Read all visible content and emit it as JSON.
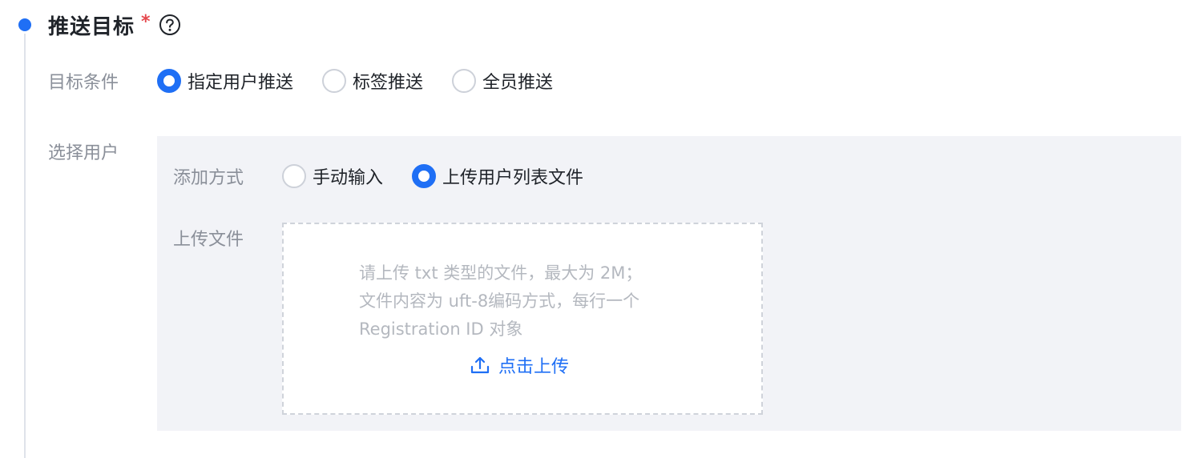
{
  "section": {
    "title": "推送目标",
    "required_mark": "*"
  },
  "target_condition": {
    "label": "目标条件",
    "options": [
      {
        "label": "指定用户推送",
        "checked": true
      },
      {
        "label": "标签推送",
        "checked": false
      },
      {
        "label": "全员推送",
        "checked": false
      }
    ]
  },
  "select_user": {
    "label": "选择用户",
    "add_method": {
      "label": "添加方式",
      "options": [
        {
          "label": "手动输入",
          "checked": false
        },
        {
          "label": "上传用户列表文件",
          "checked": true
        }
      ]
    },
    "upload": {
      "label": "上传文件",
      "hint_lines": [
        "请上传 txt 类型的文件，最大为 2M；",
        "文件内容为 uft-8编码方式，每行一个",
        "Registration ID 对象"
      ],
      "action_label": "点击上传"
    }
  },
  "colors": {
    "accent": "#1f6ff5",
    "required": "#e5484d",
    "label": "#8a8f99",
    "panel_bg": "#f2f3f7",
    "hint_text": "#b4b8bf"
  },
  "icons": {
    "help": "question-circle-icon",
    "upload": "upload-icon"
  }
}
